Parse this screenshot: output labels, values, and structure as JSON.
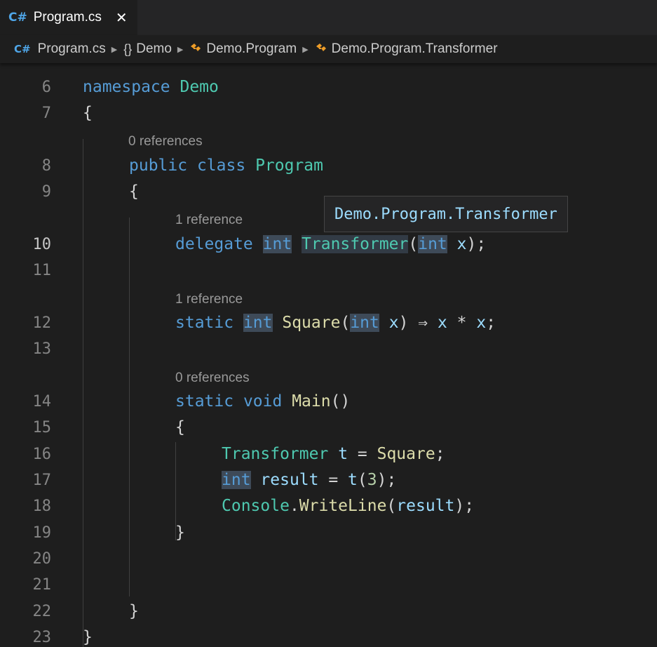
{
  "tab": {
    "icon": "C#",
    "label": "Program.cs",
    "close": "✕"
  },
  "breadcrumb": {
    "file_icon": "C#",
    "file": "Program.cs",
    "namespace_icon": "{}",
    "namespace": "Demo",
    "class": "Demo.Program",
    "member": "Demo.Program.Transformer"
  },
  "tooltip": "Demo.Program.Transformer",
  "editor": {
    "line_numbers": [
      "6",
      "7",
      "8",
      "9",
      "10",
      "11",
      "12",
      "13",
      "14",
      "15",
      "16",
      "17",
      "18",
      "19",
      "20",
      "21",
      "22",
      "23"
    ],
    "codelens": {
      "class_program": "0 references",
      "delegate": "1 reference",
      "square": "1 reference",
      "main": "0 references"
    },
    "tokens": {
      "namespace_kw": "namespace",
      "namespace_name": "Demo",
      "brace_open": "{",
      "brace_close": "}",
      "public_kw": "public",
      "class_kw": "class",
      "program_name": "Program",
      "delegate_kw": "delegate",
      "int_kw": "int",
      "transformer_name": "Transformer",
      "paren_open": "(",
      "param_x": "x",
      "paren_close_semi": ");",
      "static_kw": "static",
      "square_name": "Square",
      "lambda_body_arrow": ") ⇒ ",
      "lambda_x1": "x",
      "times": " * ",
      "lambda_x2": "x",
      "semicolon": ";",
      "void_kw": "void",
      "main_name": "Main",
      "empty_parens": "()",
      "var_t": "t",
      "assign": " = ",
      "result_var": "result",
      "call_t": "t",
      "num_3": "3",
      "console_name": "Console",
      "dot": ".",
      "writeline_name": "WriteLine",
      "result_arg": "result"
    }
  }
}
